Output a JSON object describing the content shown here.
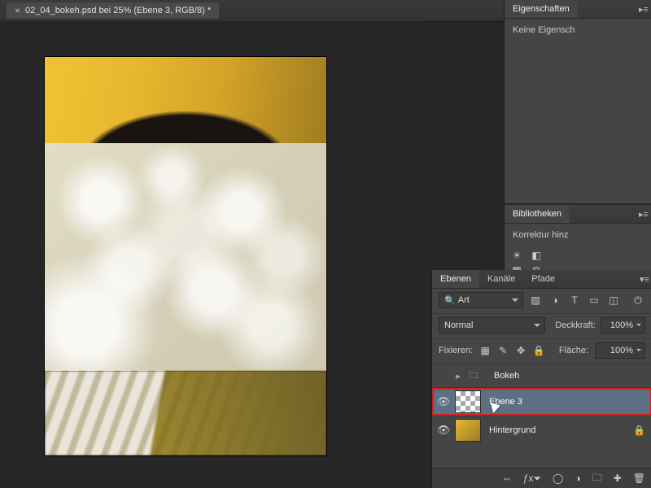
{
  "tab": {
    "close": "×",
    "title": "02_04_bokeh.psd bei 25% (Ebene 3, RGB/8) *"
  },
  "properties": {
    "tab": "Eigenschaften",
    "text": "Keine Eigensch"
  },
  "library": {
    "tab": "Bibliotheken",
    "text": "Korrektur hinz"
  },
  "layers": {
    "tabs": {
      "layers": "Ebenen",
      "channels": "Kanäle",
      "paths": "Pfade"
    },
    "kind_label": "Art",
    "blend": "Normal",
    "opacity_label": "Deckkraft:",
    "opacity_value": "100%",
    "lock_label": "Fixieren:",
    "fill_label": "Fläche:",
    "fill_value": "100%",
    "items": [
      {
        "name": "Bokeh"
      },
      {
        "name": "Ebene 3"
      },
      {
        "name": "Hintergrund"
      }
    ],
    "search_glyph": "🔍"
  }
}
